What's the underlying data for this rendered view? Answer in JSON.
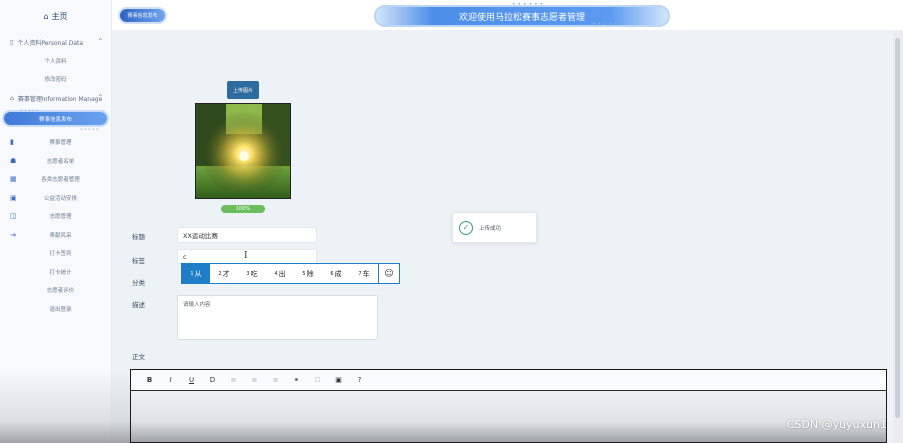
{
  "sidebar": {
    "home": "主页",
    "group1": {
      "label": "个人资料Personal Data",
      "items": [
        "个人资料",
        "修改密码"
      ]
    },
    "group2": {
      "label": "赛事管理Information Manage",
      "active_item": "赛事信息发布"
    },
    "items": [
      {
        "icon": "bookmark-icon",
        "label": "赛事管理"
      },
      {
        "icon": "user-icon",
        "label": "志愿者名单"
      },
      {
        "icon": "calendar-icon",
        "label": "各类志愿者管理"
      },
      {
        "icon": "calendar-check-icon",
        "label": "公益活动安排"
      },
      {
        "icon": "book-icon",
        "label": "志愿管理"
      },
      {
        "icon": "logout-icon",
        "label": "奉献风采"
      },
      {
        "icon": "",
        "label": "打卡签到"
      },
      {
        "icon": "",
        "label": "打卡统计"
      },
      {
        "icon": "",
        "label": "志愿者评价"
      },
      {
        "icon": "",
        "label": "退出登录"
      }
    ]
  },
  "header": {
    "tab": "赛事信息发布",
    "title": "欢迎使用马拉松赛事志愿者管理"
  },
  "form": {
    "upload_button": "上传图片",
    "progress": {
      "value": 100,
      "label": "100%"
    },
    "toast": "上传成功",
    "fields": {
      "title_label": "标题",
      "title_value": "XX运动比赛",
      "tag_label": "标签",
      "tag_value": "c",
      "category_label": "分类",
      "desc_label": "描述",
      "desc_placeholder": "请输入内容"
    },
    "body_label": "正文"
  },
  "ime": {
    "candidates": [
      {
        "num": "1",
        "text": "从"
      },
      {
        "num": "2",
        "text": "才"
      },
      {
        "num": "3",
        "text": "吃"
      },
      {
        "num": "4",
        "text": "出"
      },
      {
        "num": "5",
        "text": "除"
      },
      {
        "num": "6",
        "text": "成"
      },
      {
        "num": "7",
        "text": "车"
      }
    ],
    "emoji": "☺"
  },
  "editor": {
    "tools": [
      "B",
      "I",
      "U",
      "D",
      "≡",
      "≡",
      "≡",
      "⚭",
      "☐",
      "▣",
      "?"
    ]
  },
  "watermark": "CSDN @yuyuxun1",
  "colors": {
    "accent": "#2e6b9e",
    "nav_active": "#3f7ad9",
    "success": "#2f9d8e",
    "ime_blue": "#1f7ec7"
  }
}
